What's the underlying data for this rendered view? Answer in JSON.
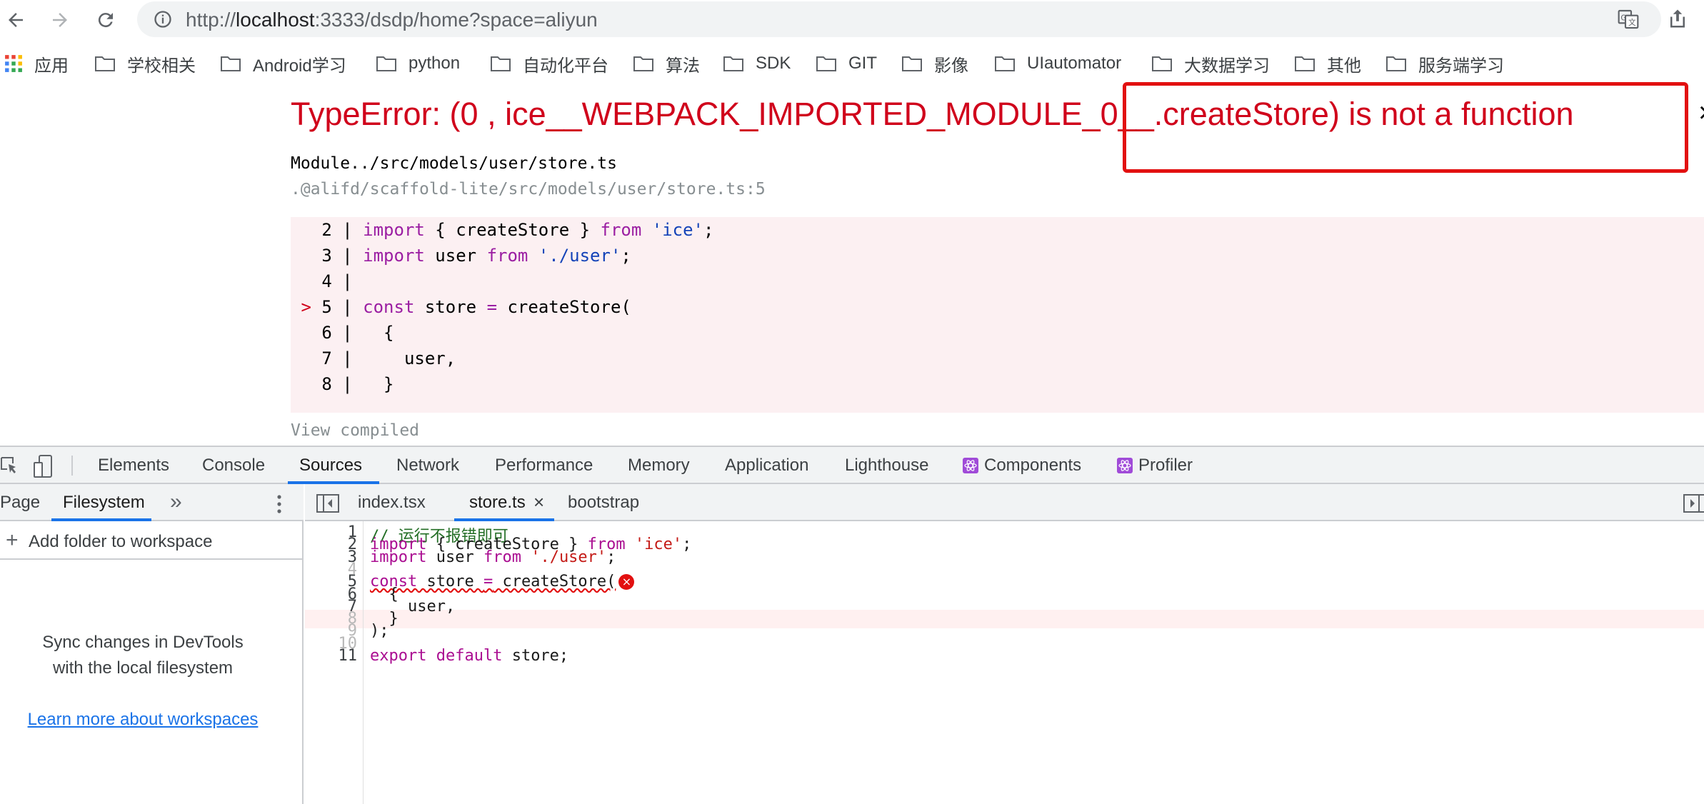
{
  "browser": {
    "url_prefix": "http://",
    "url_host": "localhost",
    "url_rest": ":3333/dsdp/home?space=aliyun",
    "bookmarks": [
      "应用",
      "学校相关",
      "Android学习",
      "python",
      "自动化平台",
      "算法",
      "SDK",
      "GIT",
      "影像",
      "UIautomator",
      "大数据学习",
      "其他",
      "服务端学习"
    ]
  },
  "error_overlay": {
    "title": "TypeError: (0 , ice__WEBPACK_IMPORTED_MODULE_0__.createStore) is not a function",
    "module_line": "Module../src/models/user/store.ts",
    "module_path": ".@alifd/scaffold-lite/src/models/user/store.ts:5",
    "view_compiled": "View compiled",
    "code_lines": [
      {
        "marker": " ",
        "num": "2",
        "code": "import { createStore } from 'ice';"
      },
      {
        "marker": " ",
        "num": "3",
        "code": "import user from './user';"
      },
      {
        "marker": " ",
        "num": "4",
        "code": ""
      },
      {
        "marker": ">",
        "num": "5",
        "code": "const store = createStore("
      },
      {
        "marker": " ",
        "num": "6",
        "code": "  {"
      },
      {
        "marker": " ",
        "num": "7",
        "code": "    user,"
      },
      {
        "marker": " ",
        "num": "8",
        "code": "  }"
      }
    ]
  },
  "devtools": {
    "tabs": [
      "Elements",
      "Console",
      "Sources",
      "Network",
      "Performance",
      "Memory",
      "Application",
      "Lighthouse",
      "Components",
      "Profiler"
    ],
    "active_tab": "Sources",
    "nav_tabs": [
      "Page",
      "Filesystem"
    ],
    "add_folder": "Add folder to workspace",
    "sync_line1": "Sync changes in DevTools",
    "sync_line2": "with the local filesystem",
    "learn_more": "Learn more about workspaces",
    "editor_tabs": [
      "index.tsx",
      "store.ts",
      "bootstrap"
    ],
    "active_editor_tab": "store.ts",
    "editor_lines": [
      {
        "num": "1",
        "text": "// 运行不报错即可"
      },
      {
        "num": "2",
        "text": "import { createStore } from 'ice';"
      },
      {
        "num": "3",
        "text": "import user from './user';"
      },
      {
        "num": "4",
        "text": ""
      },
      {
        "num": "5",
        "text": "const store = createStore("
      },
      {
        "num": "6",
        "text": "  {"
      },
      {
        "num": "7",
        "text": "    user,"
      },
      {
        "num": "8",
        "text": "  }"
      },
      {
        "num": "9",
        "text": ");"
      },
      {
        "num": "10",
        "text": ""
      },
      {
        "num": "11",
        "text": "export default store;"
      }
    ]
  },
  "colors": {
    "error_red": "#d0021b",
    "annotation_box": "#e21010",
    "accent_blue": "#1a73e8"
  }
}
